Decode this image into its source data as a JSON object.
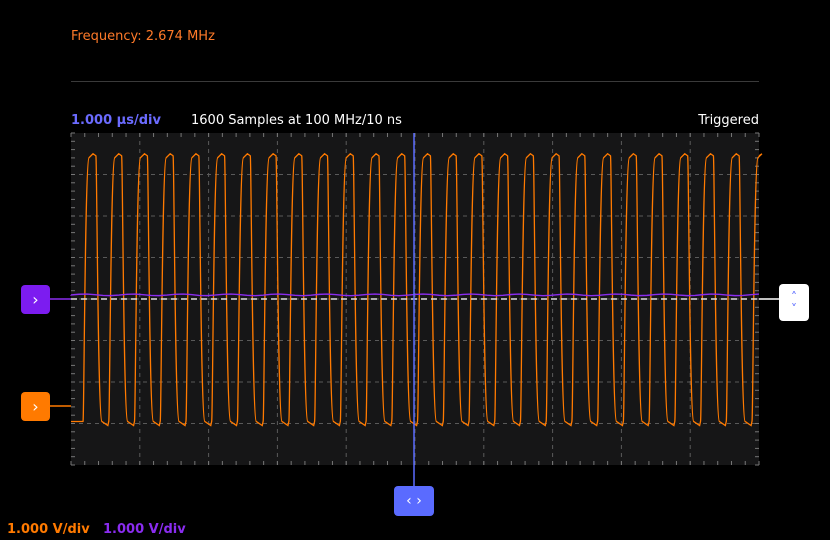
{
  "header": {
    "frequency": "Frequency: 2.674 MHz"
  },
  "status": {
    "timebase": "1.000 µs/div",
    "samples": "1600 Samples at 100 MHz/10 ns",
    "trigger_state": "Triggered"
  },
  "channels": [
    {
      "name": "ch1",
      "scale": "1.000 V/div",
      "color": "#ff7a00"
    },
    {
      "name": "ch2",
      "scale": "1.000 V/div",
      "color": "#8a2cf0"
    }
  ],
  "colors": {
    "grid": "#5a5a5a",
    "plot_bg": "#161617",
    "time_cursor": "#5a6bff",
    "trigger_line": "#dddddd"
  },
  "icons": {
    "ch1_handle": "chevron-right-icon",
    "ch2_handle": "chevron-right-icon",
    "time_handle": "chevrons-left-right-icon",
    "trigger_handle": "chevrons-up-down-icon"
  },
  "handles": {
    "ch1_glyph": "›",
    "ch2_glyph": "›",
    "time_glyph": "‹ ›",
    "trigger_up": "˄",
    "trigger_down": "˅"
  },
  "chart_data": {
    "type": "line",
    "grid": true,
    "x_divisions": 10,
    "y_divisions": 8,
    "series": [
      {
        "channel": "ch1",
        "shape": "square",
        "frequency_mhz": 2.674,
        "high_div": 3.5,
        "low_div": -3.0
      },
      {
        "channel": "ch2",
        "shape": "flat",
        "level_div": 0.1
      }
    ]
  }
}
